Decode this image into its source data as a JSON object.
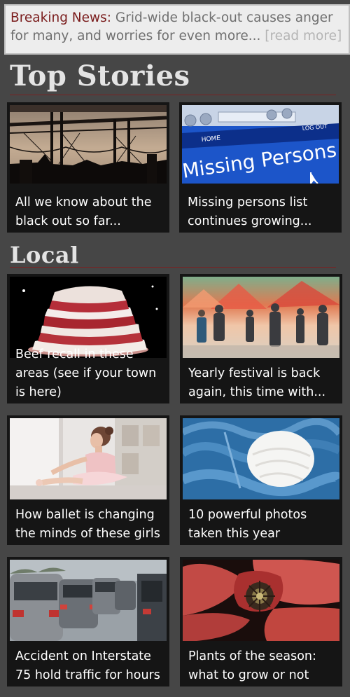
{
  "breaking": {
    "label": "Breaking News:",
    "text": " Grid-wide black-out causes anger for many, and worries for even more... ",
    "more": "[read more]"
  },
  "sections": {
    "top": "Top Stories",
    "local": "Local"
  },
  "stories": {
    "top": [
      {
        "title": "All we know about the black out so far...",
        "image": "power-lines-silhouette"
      },
      {
        "title": "Missing persons list continues growing...",
        "image": "missing-persons-web-page"
      }
    ],
    "local": [
      {
        "title": "Beef recall in these areas (see if your town is here)",
        "image": "stack-of-raw-beef"
      },
      {
        "title": "Yearly festival is back again, this time with...",
        "image": "festival-crowd"
      },
      {
        "title": "How ballet is changing the minds of these girls",
        "image": "young-ballerina-by-window"
      },
      {
        "title": "10 powerful photos taken this year",
        "image": "blue-and-white-yarn"
      },
      {
        "title": "Accident on Interstate 75 hold traffic for hours",
        "image": "traffic-jam"
      },
      {
        "title": "Plants of the season: what to grow or not",
        "image": "red-poppy-flower"
      }
    ]
  },
  "thumbnail_text": {
    "home": "HOME",
    "logout": "LOG OUT",
    "missing": "Missing Persons"
  },
  "colors": {
    "page_background": "#464646",
    "banner_background": "#ededed",
    "breaking_label": "#7a1c1c",
    "section_rule": "#7a2222",
    "card_background": "#151515"
  }
}
